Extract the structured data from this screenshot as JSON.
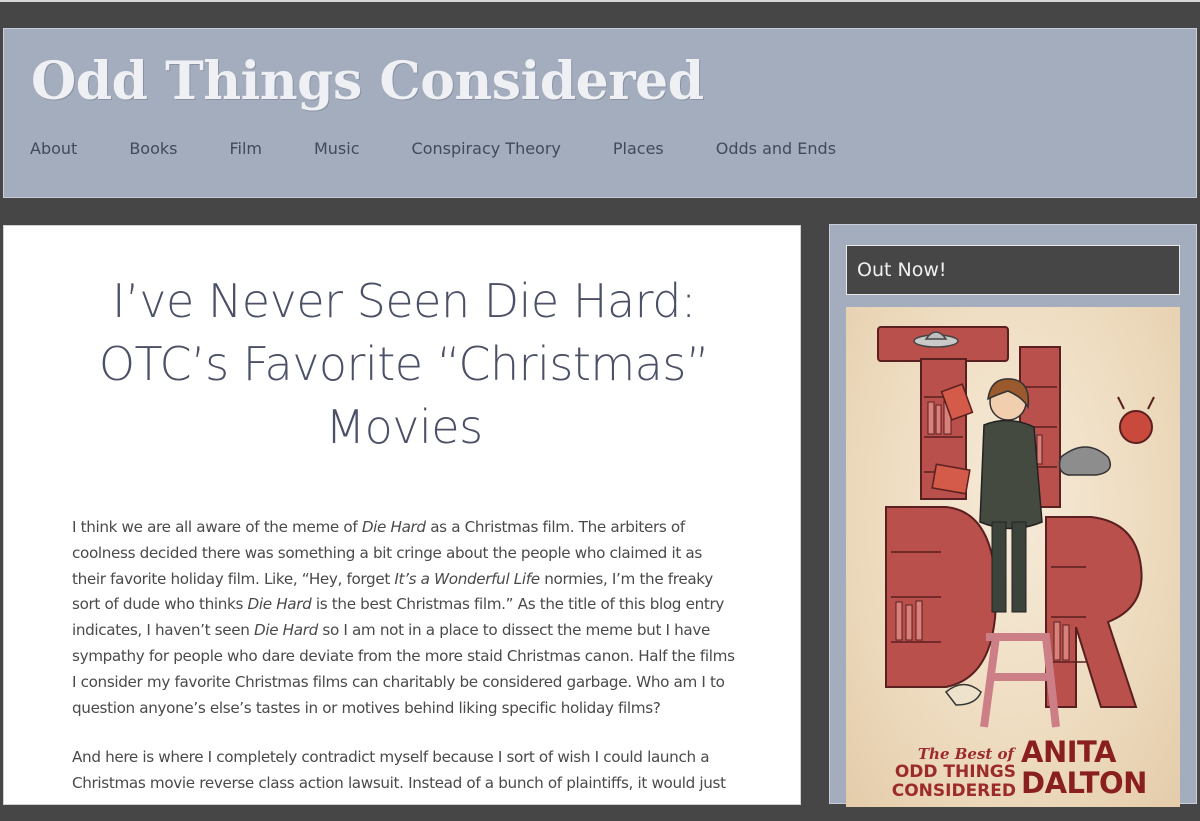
{
  "site": {
    "title": "Odd Things Considered",
    "nav": [
      "About",
      "Books",
      "Film",
      "Music",
      "Conspiracy Theory",
      "Places",
      "Odds and Ends"
    ]
  },
  "post": {
    "title": "I’ve Never Seen Die Hard: OTC’s Favorite “Christmas” Movies",
    "paragraphs": [
      [
        {
          "t": "I think we are all aware of the meme of "
        },
        {
          "t": "Die Hard",
          "em": true
        },
        {
          "t": " as a Christmas film. The arbiters of coolness decided there was something a bit cringe about the people who claimed it as their favorite holiday film. Like, “Hey, forget "
        },
        {
          "t": "It’s a Wonderful Life",
          "em": true
        },
        {
          "t": " normies, I’m the freaky sort of dude who thinks "
        },
        {
          "t": "Die Hard",
          "em": true
        },
        {
          "t": " is the best Christmas film.” As the title of this blog entry indicates, I haven’t seen "
        },
        {
          "t": "Die Hard",
          "em": true
        },
        {
          "t": " so I am not in a place to dissect the meme but I have sympathy for people who dare deviate from the more staid Christmas canon. Half the films I consider my favorite Christmas films can charitably be considered garbage. Who am I to question anyone’s else’s tastes in or motives behind liking specific holiday films?"
        }
      ],
      [
        {
          "t": "And here is where I completely contradict myself because I sort of wish I could launch a Christmas movie reverse class action lawsuit. Instead of a bunch of plaintiffs, it would just"
        }
      ]
    ]
  },
  "sidebar": {
    "widget_title": "Out Now!",
    "book": {
      "subtitle": "The Best of",
      "title": "ODD THINGS\nCONSIDERED",
      "author": "ANITA\nDALTON"
    }
  },
  "colors": {
    "background": "#464646",
    "header": "#a4adbd",
    "title_text": "#4b5066",
    "book_red": "#9c2b2b"
  }
}
